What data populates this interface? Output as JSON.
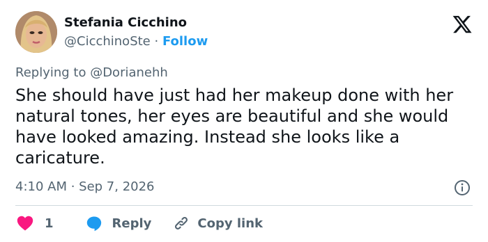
{
  "author": {
    "display_name": "Stefania Cicchino",
    "handle": "@CicchinoSte",
    "separator": "·",
    "follow_label": "Follow"
  },
  "reply_to": "Replying to @Dorianehh",
  "tweet": {
    "text": "She should have just had her makeup done with her natural tones, her eyes are beautiful and she would have looked amazing. Instead she looks like a caricature."
  },
  "meta": {
    "timestamp": "4:10 AM · Sep 7, 2026"
  },
  "actions": {
    "like_count": "1",
    "reply_label": "Reply",
    "copy_link_label": "Copy link"
  },
  "icons": {
    "logo": "x-logo-icon",
    "info": "info-icon",
    "like": "heart-icon",
    "reply": "speech-bubble-icon",
    "copy": "link-icon"
  },
  "colors": {
    "text": "#0f1419",
    "secondary": "#536471",
    "accent": "#1d9bf0",
    "like": "#f91880",
    "divider": "#cfd9de"
  }
}
